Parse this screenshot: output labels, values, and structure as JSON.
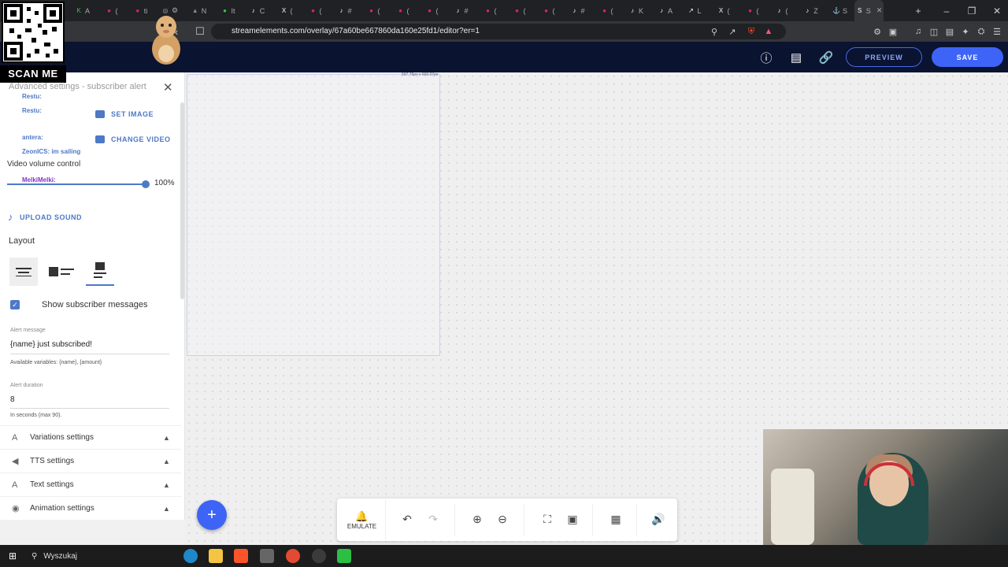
{
  "browser": {
    "url": "streamelements.com/overlay/67a60be667860da160e25fd1/editor?er=1",
    "tabs": [
      {
        "icon": "K",
        "label": "A",
        "color": "#2ecc40"
      },
      {
        "icon": "●",
        "label": "(",
        "color": "#e0245e"
      },
      {
        "icon": "●",
        "label": "ti",
        "color": "#e0245e"
      },
      {
        "icon": "◎",
        "label": "⚙",
        "color": "#aaa"
      },
      {
        "icon": "▲",
        "label": "N",
        "color": "#888"
      },
      {
        "icon": "●",
        "label": "It",
        "color": "#2ecc40"
      },
      {
        "icon": "♪",
        "label": "C",
        "color": "#fff"
      },
      {
        "icon": "X",
        "label": "(",
        "color": "#fff"
      },
      {
        "icon": "●",
        "label": "(",
        "color": "#e0245e"
      },
      {
        "icon": "♪",
        "label": "#",
        "color": "#fff"
      },
      {
        "icon": "●",
        "label": "(",
        "color": "#e0245e"
      },
      {
        "icon": "●",
        "label": "(",
        "color": "#e0245e"
      },
      {
        "icon": "●",
        "label": "(",
        "color": "#e0245e"
      },
      {
        "icon": "♪",
        "label": "#",
        "color": "#fff"
      },
      {
        "icon": "●",
        "label": "(",
        "color": "#e0245e"
      },
      {
        "icon": "●",
        "label": "(",
        "color": "#e0245e"
      },
      {
        "icon": "●",
        "label": "(",
        "color": "#e0245e"
      },
      {
        "icon": "♪",
        "label": "#",
        "color": "#fff"
      },
      {
        "icon": "●",
        "label": "(",
        "color": "#e0245e"
      },
      {
        "icon": "♪",
        "label": "K",
        "color": "#fff"
      },
      {
        "icon": "♪",
        "label": "A",
        "color": "#fff"
      },
      {
        "icon": "↗",
        "label": "L",
        "color": "#fff"
      },
      {
        "icon": "X",
        "label": "(",
        "color": "#fff"
      },
      {
        "icon": "●",
        "label": "(",
        "color": "#e0245e"
      },
      {
        "icon": "♪",
        "label": "(",
        "color": "#fff"
      },
      {
        "icon": "♪",
        "label": "Z",
        "color": "#fff"
      },
      {
        "icon": "⚓",
        "label": "S",
        "color": "#fff"
      },
      {
        "icon": "S",
        "label": "S",
        "color": "#fff",
        "active": true
      }
    ]
  },
  "header": {
    "preview_label": "PREVIEW",
    "save_label": "SAVE"
  },
  "overlay": {
    "scan_me": "SCAN ME",
    "chat_lines": [
      {
        "text": "Restu:",
        "color": "#4d79c7"
      },
      {
        "text": "Restu:",
        "color": "#4d79c7"
      },
      {
        "text": "antera:",
        "color": "#4d79c7"
      },
      {
        "text": "ZeonICS: im sailing",
        "color": "#4d79c7"
      },
      {
        "text": "MelkiMelki:",
        "color": "#8b2fc9"
      }
    ]
  },
  "sidebar": {
    "title": "Advanced settings - subscriber alert",
    "set_image": "SET IMAGE",
    "change_video": "CHANGE VIDEO",
    "video_volume_label": "Video volume control",
    "video_volume_value": "100%",
    "video_volume_level": 1.0,
    "upload_sound": "UPLOAD SOUND",
    "layout_label": "Layout",
    "show_messages_label": "Show subscriber messages",
    "show_messages_checked": true,
    "alert_message_label": "Alert message",
    "alert_message_value": "{name} just subscribed!",
    "available_variables": "Available variables: {name}, {amount}",
    "alert_duration_label": "Alert duration",
    "alert_duration_value": "8",
    "alert_duration_hint": "In seconds (max 90).",
    "sections": [
      {
        "label": "Variations settings",
        "icon": "A"
      },
      {
        "label": "TTS settings",
        "icon": "◀"
      },
      {
        "label": "Text settings",
        "icon": "A"
      },
      {
        "label": "Animation settings",
        "icon": "◉"
      }
    ]
  },
  "canvas": {
    "widget_dims": "597.76px x 669.07px"
  },
  "toolbar": {
    "emulate_label": "EMULATE"
  },
  "taskbar": {
    "search_placeholder": "Wyszukaj"
  },
  "colors": {
    "accent": "#3d64f6",
    "link": "#4d79c7",
    "header_bg": "#0a1330"
  }
}
